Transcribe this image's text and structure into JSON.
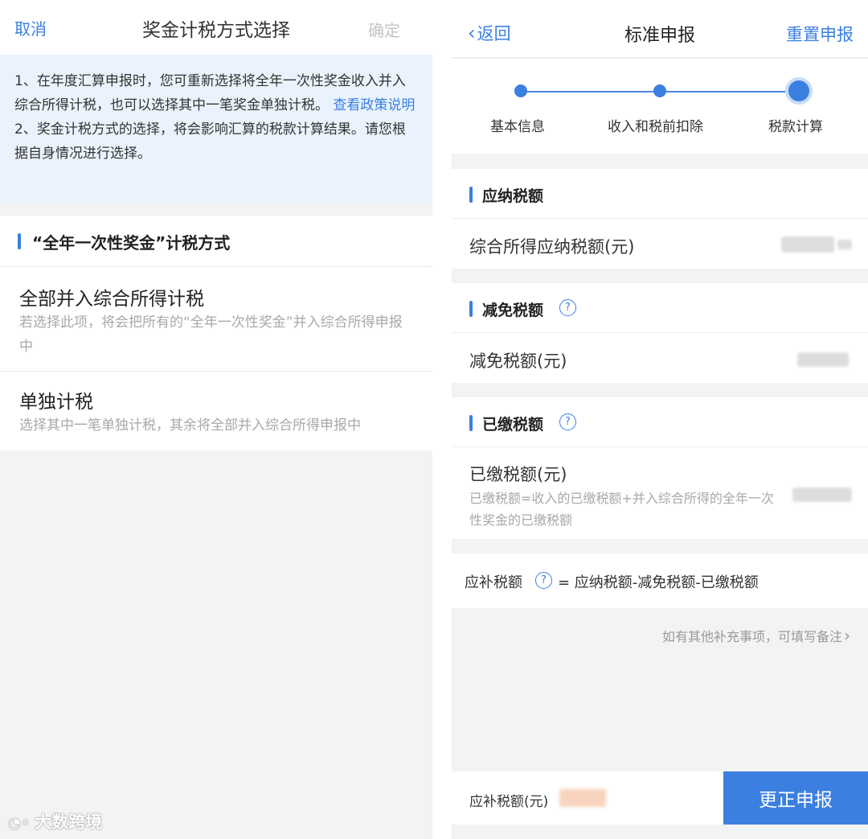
{
  "left": {
    "header": {
      "cancel": "取消",
      "title": "奖金计税方式选择",
      "confirm": "确定"
    },
    "notice": {
      "line1": "1、在年度汇算申报时，您可重新选择将全年一次性奖金收入并入综合所得计税，也可以选择其中一笔奖金单独计税。",
      "link": "查看政策说明",
      "line2": "2、奖金计税方式的选择，将会影响汇算的税款计算结果。请您根据自身情况进行选择。"
    },
    "section_title": "“全年一次性奖金”计税方式",
    "options": [
      {
        "title": "全部并入综合所得计税",
        "desc": "若选择此项，将会把所有的“全年一次性奖金”并入综合所得申报中"
      },
      {
        "title": "单独计税",
        "desc": "选择其中一笔单独计税，其余将全部并入综合所得申报中"
      }
    ],
    "watermark": "大数跨境"
  },
  "right": {
    "header": {
      "back": "返回",
      "title": "标准申报",
      "reset": "重置申报"
    },
    "steps": [
      "基本信息",
      "收入和税前扣除",
      "税款计算"
    ],
    "sections": {
      "payable": {
        "title": "应纳税额",
        "row": "综合所得应纳税额(元)"
      },
      "reduction": {
        "title": "减免税额",
        "row": "减免税额(元)"
      },
      "paid": {
        "title": "已缴税额",
        "row": "已缴税额(元)",
        "desc": "已缴税额=收入的已缴税额+并入综合所得的全年一次性奖金的已缴税额"
      }
    },
    "formula": {
      "label": "应补税额",
      "expr": "= 应纳税额-减免税额-已缴税额"
    },
    "remark": "如有其他补充事项，可填写备注",
    "bottom": {
      "label": "应补税额(元)",
      "button": "更正申报"
    },
    "colors": {
      "accent": "#3b7fe0",
      "notice_bg": "#eaf3fd",
      "page_bg": "#f2f3f5"
    }
  }
}
